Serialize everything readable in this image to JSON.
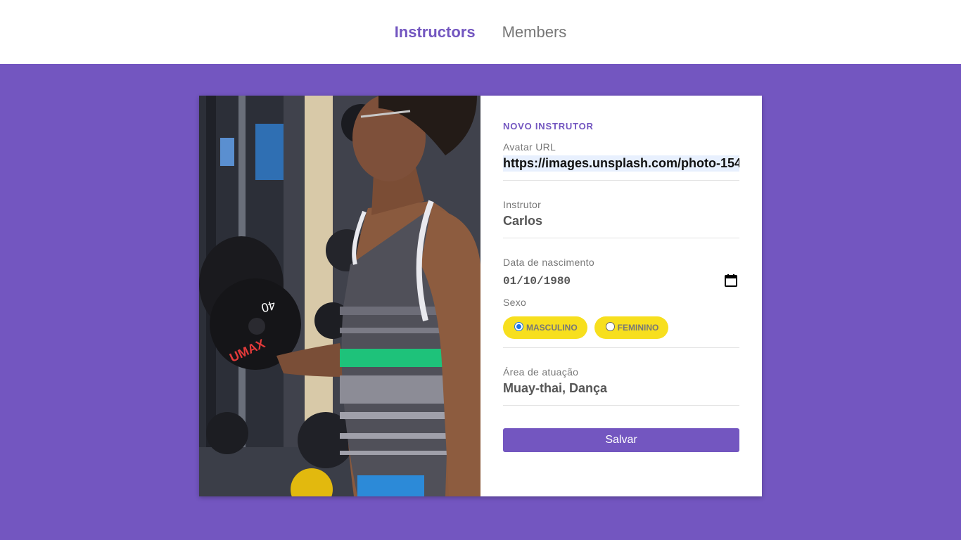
{
  "nav": {
    "instructors_label": "Instructors",
    "members_label": "Members"
  },
  "form": {
    "title": "NOVO INSTRUTOR",
    "avatar": {
      "label": "Avatar URL",
      "value": "https://images.unsplash.com/photo-154"
    },
    "name": {
      "label": "Instrutor",
      "value": "Carlos"
    },
    "birth": {
      "label": "Data de nascimento",
      "value": "01/10/1980"
    },
    "gender": {
      "label": "Sexo",
      "options": [
        {
          "label": "MASCULINO",
          "checked": true
        },
        {
          "label": "FEMININO",
          "checked": false
        }
      ]
    },
    "services": {
      "label": "Área de atuação",
      "value": "Muay-thai, Dança"
    },
    "save_label": "Salvar"
  },
  "photo": {
    "dumbbell_text": "40",
    "brand_text": "UMAX"
  },
  "colors": {
    "accent": "#7356c0",
    "pill": "#f7df1e"
  }
}
